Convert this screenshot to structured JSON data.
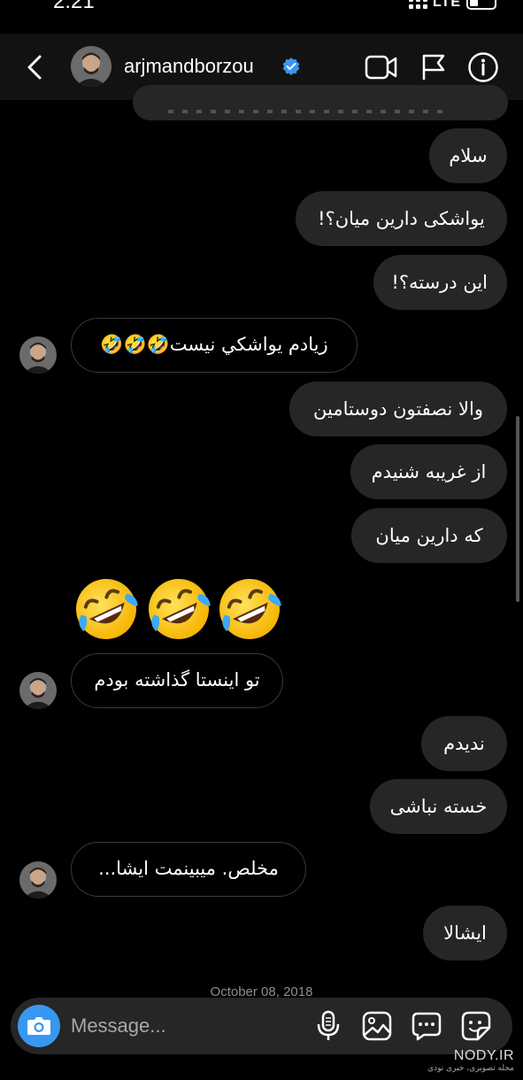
{
  "status_bar": {
    "time": "2:21",
    "network": "LTE"
  },
  "header": {
    "username": "arjmandborzou"
  },
  "messages": [
    {
      "dir": "out",
      "text": "سلام"
    },
    {
      "dir": "out",
      "text": "يواشکی دارين ميان؟!"
    },
    {
      "dir": "out",
      "text": "اين درسته؟!"
    },
    {
      "dir": "in",
      "text": "زيادم يواشکي نيست🤣🤣🤣"
    },
    {
      "dir": "out",
      "text": "والا نصفتون دوستامين"
    },
    {
      "dir": "out",
      "text": "از غريبه شنيدم"
    },
    {
      "dir": "out",
      "text": "که دارين ميان"
    },
    {
      "dir": "in",
      "text": "تو اينستا گذاشته بودم"
    },
    {
      "dir": "out",
      "text": "نديدم"
    },
    {
      "dir": "out",
      "text": "خسته نباشی"
    },
    {
      "dir": "in",
      "text": "مخلص. ميبينمت ايشا..."
    },
    {
      "dir": "out",
      "text": "ايشالا"
    }
  ],
  "big_emoji": "🤣🤣🤣",
  "date_separator": "October 08, 2018",
  "composer": {
    "placeholder": "Message..."
  },
  "watermark": {
    "name": "NODY.IR",
    "sub": "مجله تصویری، خبری نودی"
  },
  "colors": {
    "bubble_out": "#262626",
    "camera_blue": "#3897f0",
    "verified_blue": "#3897f0"
  }
}
